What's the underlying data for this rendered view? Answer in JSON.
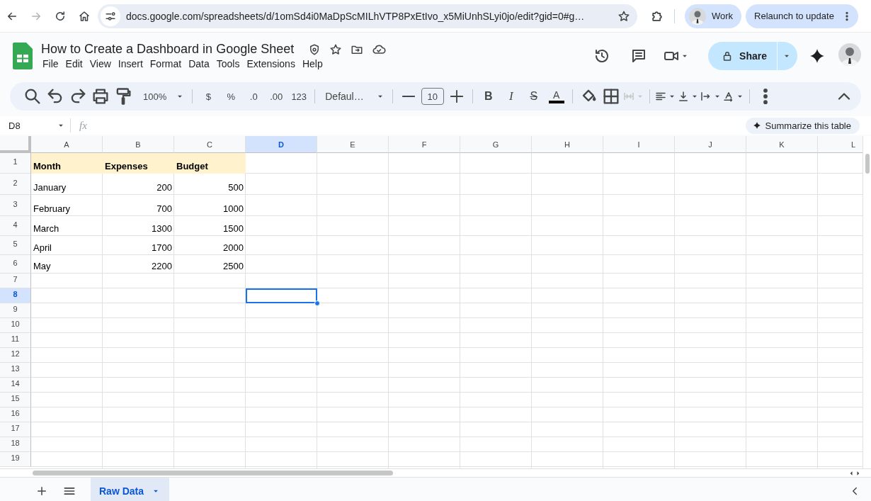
{
  "browser": {
    "url": "docs.google.com/spreadsheets/d/1omSd4i0MaDpScMILhVTP8PxEtIvo_x5MiUnhSLyi0jo/edit?gid=0#g…",
    "profile": "Work",
    "update_button": "Relaunch to update"
  },
  "document": {
    "title": "How to Create a Dashboard in Google Sheet",
    "menus": [
      "File",
      "Edit",
      "View",
      "Insert",
      "Format",
      "Data",
      "Tools",
      "Extensions",
      "Help"
    ],
    "share_button": "Share"
  },
  "toolbar": {
    "zoom": "100%",
    "currency": "$",
    "percent": "%",
    "decrease_decimals": ".0",
    "increase_decimals": ".00",
    "number_format": "123",
    "font": "Defaul…",
    "font_size": "10",
    "text_styles": [
      {
        "kind": "bold",
        "label": "B"
      },
      {
        "kind": "italic",
        "label": "I"
      },
      {
        "kind": "strikethrough",
        "label": "S"
      },
      {
        "kind": "text_color",
        "label": "A"
      }
    ],
    "merge_cells": {
      "disabled": true
    }
  },
  "formula_bar": {
    "name_box": "D8",
    "fx": "fx",
    "summarize_button": "Summarize this table"
  },
  "grid": {
    "columns": [
      {
        "label": "A",
        "selected": false
      },
      {
        "label": "B",
        "selected": false
      },
      {
        "label": "C",
        "selected": false
      },
      {
        "label": "D",
        "selected": true
      },
      {
        "label": "E",
        "selected": false
      },
      {
        "label": "F",
        "selected": false
      },
      {
        "label": "G",
        "selected": false
      },
      {
        "label": "H",
        "selected": false
      },
      {
        "label": "I",
        "selected": false
      },
      {
        "label": "J",
        "selected": false
      },
      {
        "label": "K",
        "selected": false
      },
      {
        "label": "L",
        "selected": false
      }
    ],
    "row_headers": [
      {
        "label": "1",
        "selected": false
      },
      {
        "label": "2",
        "selected": false
      },
      {
        "label": "3",
        "selected": false
      },
      {
        "label": "4",
        "selected": false
      },
      {
        "label": "5",
        "selected": false
      },
      {
        "label": "6",
        "selected": false
      },
      {
        "label": "7",
        "selected": false
      },
      {
        "label": "8",
        "selected": true
      },
      {
        "label": "9",
        "selected": false
      },
      {
        "label": "10",
        "selected": false
      },
      {
        "label": "11",
        "selected": false
      },
      {
        "label": "12",
        "selected": false
      },
      {
        "label": "13",
        "selected": false
      },
      {
        "label": "14",
        "selected": false
      },
      {
        "label": "15",
        "selected": false
      },
      {
        "label": "16",
        "selected": false
      },
      {
        "label": "17",
        "selected": false
      },
      {
        "label": "18",
        "selected": false
      },
      {
        "label": "19",
        "selected": false
      }
    ],
    "rows": [
      {
        "kind": "header",
        "cells": [
          "Month",
          "Expenses",
          "Budget"
        ]
      },
      {
        "kind": "data",
        "cells": [
          "January",
          "200",
          "500"
        ]
      },
      {
        "kind": "data",
        "cells": [
          "February",
          "700",
          "1000"
        ]
      },
      {
        "kind": "data",
        "cells": [
          "March",
          "1300",
          "1500"
        ]
      },
      {
        "kind": "data",
        "cells": [
          "April",
          "1700",
          "2000"
        ]
      },
      {
        "kind": "data",
        "cells": [
          "May",
          "2200",
          "2500"
        ]
      }
    ]
  },
  "sheets": {
    "tabs": [
      {
        "label": "Raw Data",
        "selected": true
      }
    ]
  }
}
